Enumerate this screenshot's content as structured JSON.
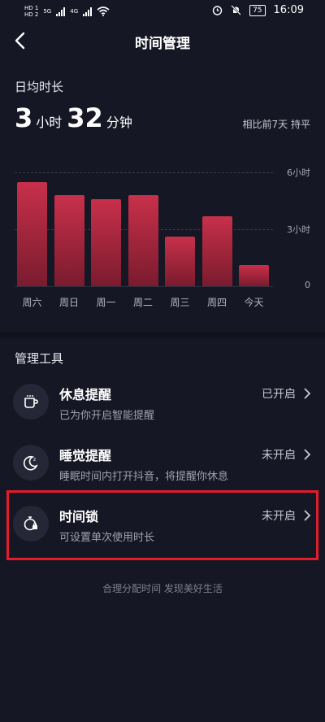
{
  "status_bar": {
    "left_tags": [
      "HD 1",
      "HD 2"
    ],
    "signal_labels": [
      "5G",
      "4G"
    ],
    "battery": "75",
    "time": "16:09"
  },
  "navbar": {
    "title": "时间管理"
  },
  "daily_average": {
    "label": "日均时长",
    "hours": "3",
    "hours_unit": "小时",
    "minutes": "32",
    "minutes_unit": "分钟",
    "comparison": "相比前7天 持平"
  },
  "chart_data": {
    "type": "bar",
    "categories": [
      "周六",
      "周日",
      "周一",
      "周二",
      "周三",
      "周四",
      "今天"
    ],
    "values": [
      5.5,
      4.8,
      4.6,
      4.8,
      2.6,
      3.7,
      1.1
    ],
    "unit": "小时",
    "ylim": [
      0,
      6
    ],
    "y_ticks": [
      "6小时",
      "3小时",
      "0"
    ],
    "grid": true
  },
  "tools": {
    "title": "管理工具",
    "items": [
      {
        "title": "休息提醒",
        "subtitle": "已为你开启智能提醒",
        "status": "已开启",
        "icon": "coffee-cup-icon"
      },
      {
        "title": "睡觉提醒",
        "subtitle": "睡眠时间内打开抖音，将提醒你休息",
        "status": "未开启",
        "icon": "moon-icon"
      },
      {
        "title": "时间锁",
        "subtitle": "可设置单次使用时长",
        "status": "未开启",
        "icon": "timer-lock-icon"
      }
    ]
  },
  "footer": "合理分配时间 发现美好生活",
  "colors": {
    "background": "#161724",
    "bar": "#b8283f",
    "highlight": "#e31b2b"
  }
}
